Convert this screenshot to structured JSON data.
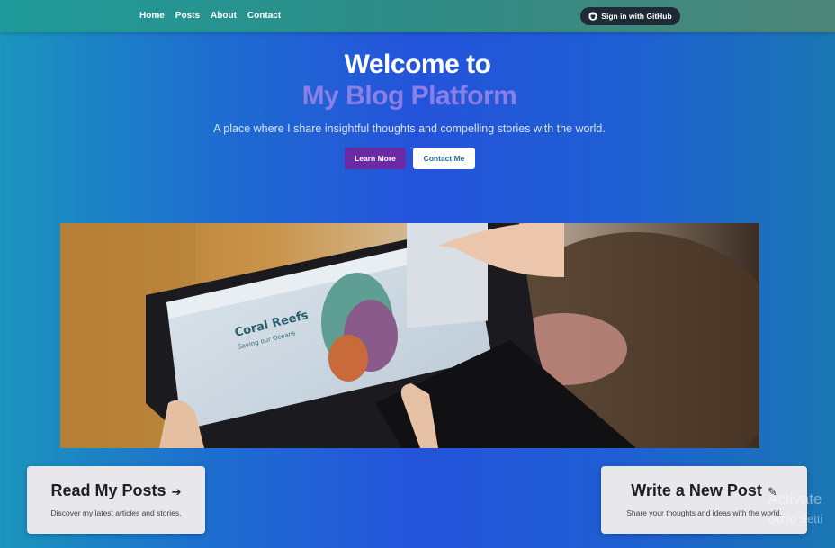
{
  "nav": {
    "links": [
      "Home",
      "Posts",
      "About",
      "Contact"
    ],
    "github_label": "Sign in with GitHub",
    "github_icon": "github-icon"
  },
  "hero": {
    "title_line1": "Welcome to",
    "title_line2": "My Blog Platform",
    "subtitle": "A place where I share insightful thoughts and compelling stories with the world.",
    "learn_more": "Learn More",
    "contact_me": "Contact Me"
  },
  "image_screen": {
    "heading": "Coral Reefs",
    "subheading": "Saving our Oceans"
  },
  "cards": {
    "read": {
      "title": "Read My Posts",
      "icon": "arrow-right-icon",
      "description": "Discover my latest articles and stories."
    },
    "write": {
      "title": "Write a New Post",
      "icon": "edit-icon",
      "description": "Share your thoughts and ideas with the world."
    }
  },
  "watermark": {
    "line1": "Activate",
    "line2": "Go to Setti"
  },
  "colors": {
    "navbar": "#2f8c86",
    "accent_purple": "#6b2aa3",
    "title_secondary": "#8a7fe6",
    "github_button": "#1f2a37"
  }
}
